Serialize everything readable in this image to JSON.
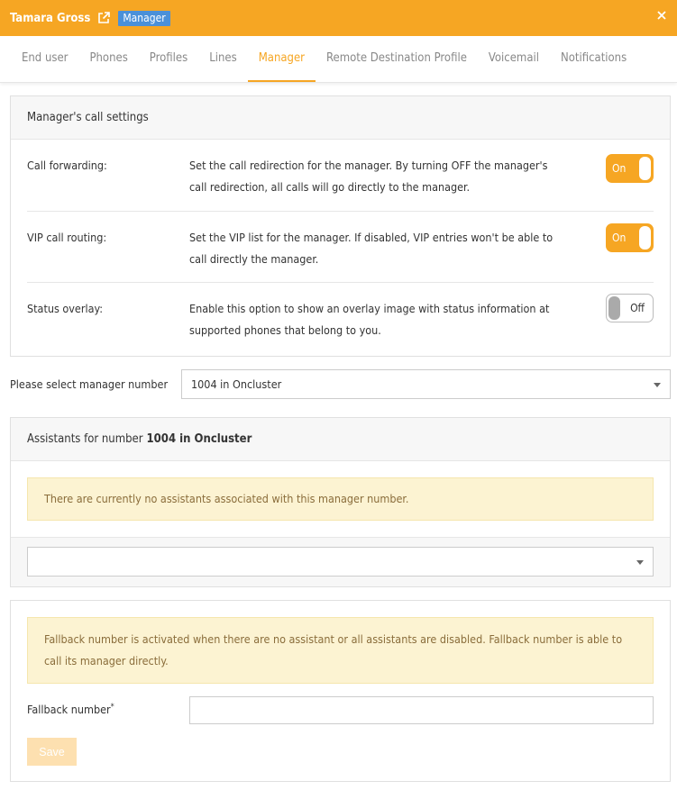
{
  "header": {
    "user_name": "Tamara Gross",
    "badge": "Manager",
    "accent_color": "#f6a623",
    "badge_color": "#4a90d9",
    "icons": [
      "external-link-icon",
      "close-icon"
    ]
  },
  "tabs": [
    {
      "label": "End user",
      "active": false
    },
    {
      "label": "Phones",
      "active": false
    },
    {
      "label": "Profiles",
      "active": false
    },
    {
      "label": "Lines",
      "active": false
    },
    {
      "label": "Manager",
      "active": true
    },
    {
      "label": "Remote Destination Profile",
      "active": false
    },
    {
      "label": "Voicemail",
      "active": false
    },
    {
      "label": "Notifications",
      "active": false
    }
  ],
  "call_settings": {
    "title": "Manager's call settings",
    "rows": [
      {
        "label": "Call forwarding:",
        "desc": "Set the call redirection for the manager. By turning OFF the manager's call redirection, all calls will go directly to the manager.",
        "state": "On"
      },
      {
        "label": "VIP call routing:",
        "desc": "Set the VIP list for the manager. If disabled, VIP entries won't be able to call directly the manager.",
        "state": "On"
      },
      {
        "label": "Status overlay:",
        "desc": "Enable this option to show an overlay image with status information at supported phones that belong to you.",
        "state": "Off"
      }
    ]
  },
  "manager_number": {
    "label": "Please select manager number",
    "value": "1004 in Oncluster"
  },
  "assistants": {
    "title_prefix": "Assistants for number",
    "title_number": "1004 in Oncluster",
    "alert": "There are currently no assistants associated with this manager number.",
    "select_value": ""
  },
  "fallback": {
    "alert": "Fallback number is activated when there are no assistant or all assistants are disabled. Fallback number is able to call its manager directly.",
    "label": "Fallback number",
    "required_mark": "*",
    "input_value": "",
    "save_label": "Save"
  }
}
